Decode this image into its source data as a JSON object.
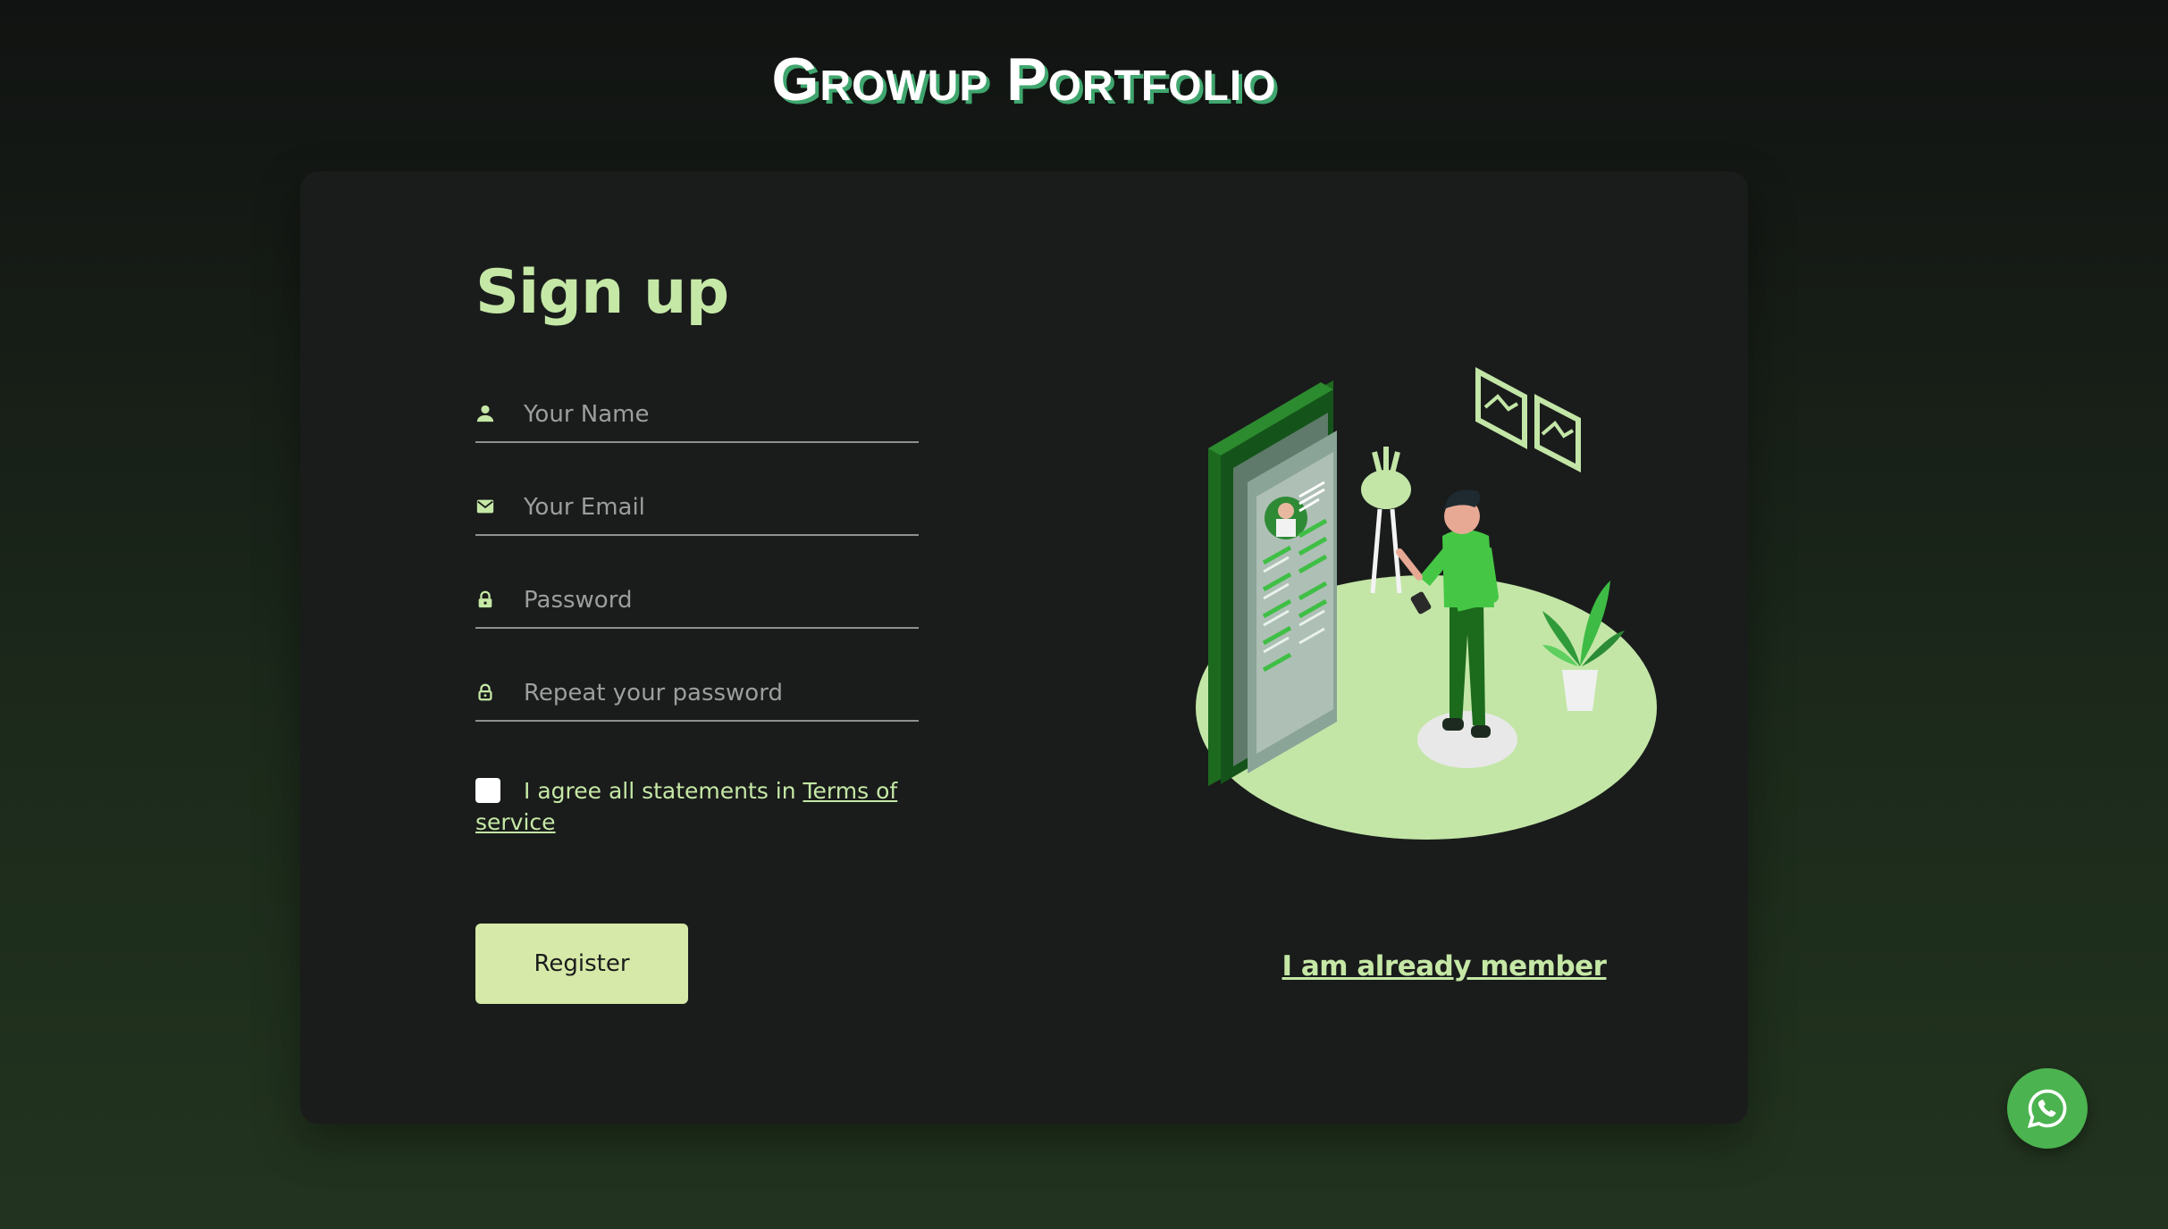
{
  "brand": {
    "title": "Growup Portfolio"
  },
  "signup": {
    "heading": "Sign up",
    "fields": [
      {
        "icon": "person-icon",
        "placeholder": "Your Name",
        "value": ""
      },
      {
        "icon": "email-icon",
        "placeholder": "Your Email",
        "value": ""
      },
      {
        "icon": "lock-icon",
        "placeholder": "Password",
        "value": ""
      },
      {
        "icon": "lock-outline-icon",
        "placeholder": "Repeat your password",
        "value": ""
      }
    ],
    "agree": {
      "text": "I agree all statements in ",
      "link": "Terms of service",
      "checked": false
    },
    "register_label": "Register"
  },
  "side": {
    "member_link": "I am already member",
    "illustration_icon": "portfolio-illustration"
  },
  "floating": {
    "icon": "whatsapp-icon"
  },
  "colors": {
    "accent": "#c5e8a6",
    "button_bg": "#d6e9a8",
    "card_bg": "#1a1c1b",
    "whatsapp": "#4bb34f"
  }
}
